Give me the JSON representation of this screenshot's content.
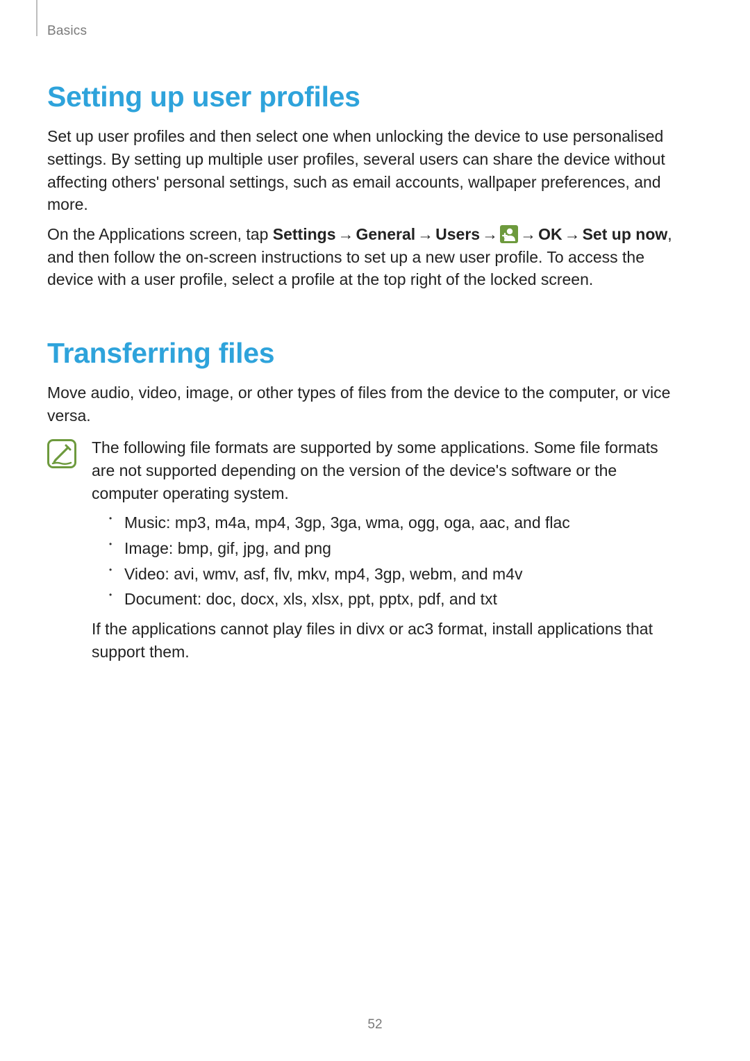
{
  "header": {
    "section": "Basics"
  },
  "page_number": "52",
  "section1": {
    "title": "Setting up user profiles",
    "p1": "Set up user profiles and then select one when unlocking the device to use personalised settings. By setting up multiple user profiles, several users can share the device without affecting others' personal settings, such as email accounts, wallpaper preferences, and more.",
    "p2_pre": "On the Applications screen, tap ",
    "path": {
      "a": "Settings",
      "b": "General",
      "c": "Users",
      "d": "OK",
      "e": "Set up now"
    },
    "p2_post": ", and then follow the on-screen instructions to set up a new user profile. To access the device with a user profile, select a profile at the top right of the locked screen.",
    "icon_name": "add-user-icon"
  },
  "section2": {
    "title": "Transferring files",
    "p1": "Move audio, video, image, or other types of files from the device to the computer, or vice versa.",
    "note_intro": "The following file formats are supported by some applications. Some file formats are not supported depending on the version of the device's software or the computer operating system.",
    "bullets": [
      "Music: mp3, m4a, mp4, 3gp, 3ga, wma, ogg, oga, aac, and flac",
      "Image: bmp, gif, jpg, and png",
      "Video: avi, wmv, asf, flv, mkv, mp4, 3gp, webm, and m4v",
      "Document: doc, docx, xls, xlsx, ppt, pptx, pdf, and txt"
    ],
    "note_outro": "If the applications cannot play files in divx or ac3 format, install applications that support them.",
    "note_icon_name": "notebook-note-icon"
  }
}
